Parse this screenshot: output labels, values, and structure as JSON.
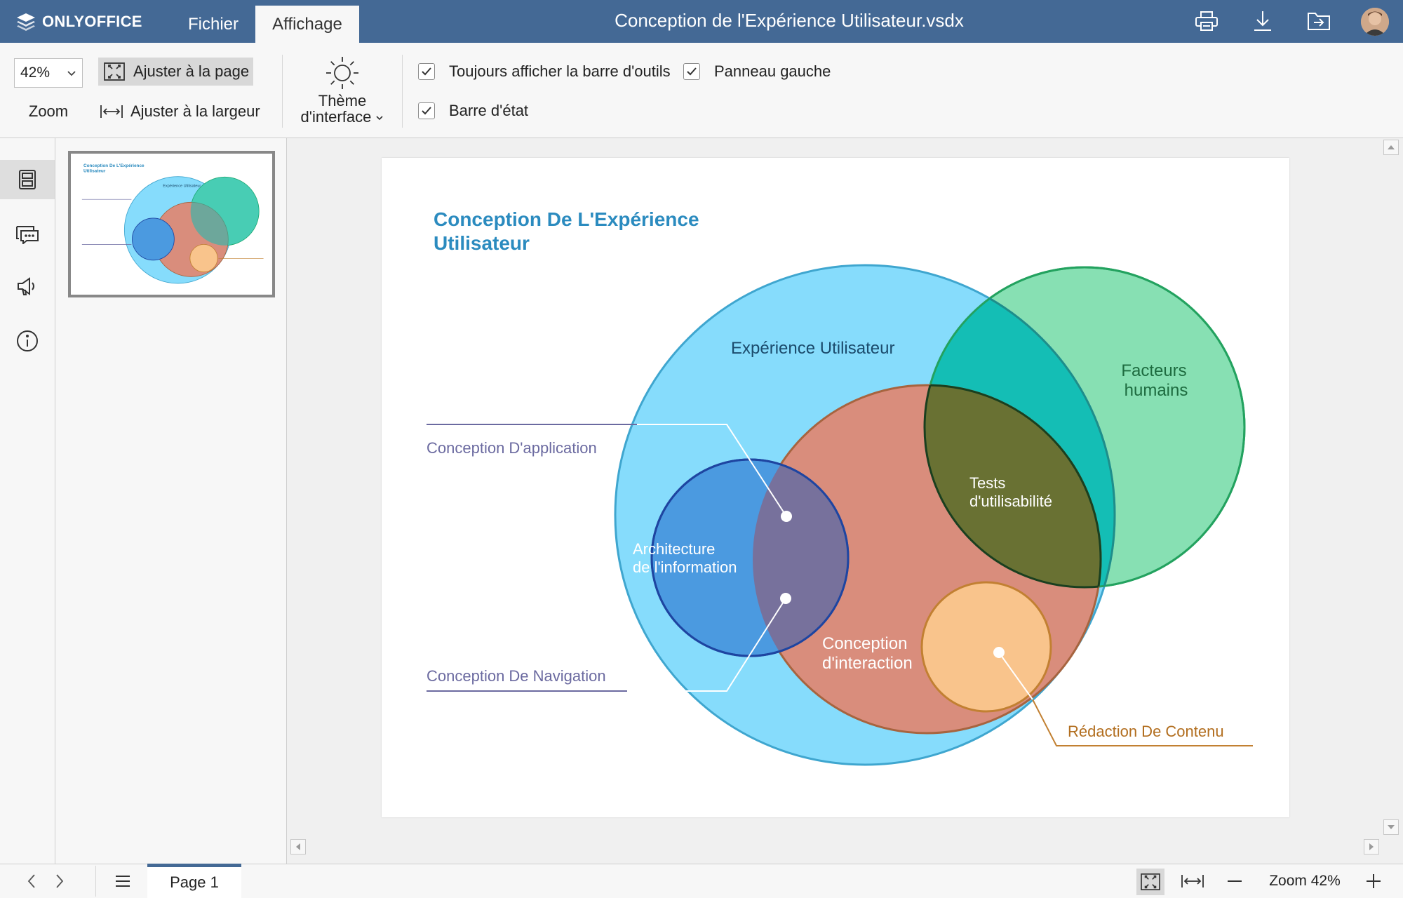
{
  "app": {
    "brand": "ONLYOFFICE",
    "title": "Conception de l'Expérience Utilisateur.vsdx"
  },
  "tabs": [
    {
      "label": "Fichier"
    },
    {
      "label": "Affichage",
      "active": true
    }
  ],
  "toolbar": {
    "zoom_value": "42%",
    "zoom_label": "Zoom",
    "fit_page": "Ajuster à la page",
    "fit_width": "Ajuster à la largeur",
    "theme_line1": "Thème",
    "theme_line2": "d'interface",
    "checkboxes": [
      {
        "label": "Toujours afficher la barre d'outils",
        "checked": true
      },
      {
        "label": "Panneau gauche",
        "checked": true
      },
      {
        "label": "Barre d'état",
        "checked": true
      }
    ]
  },
  "header_icons": [
    "print-icon",
    "download-icon",
    "open-location-icon",
    "user-avatar"
  ],
  "left_rail_icons": [
    "pages-icon",
    "comments-icon",
    "speaker-icon",
    "info-icon"
  ],
  "diagram": {
    "title_line1": "Conception De L'Expérience",
    "title_line2": "Utilisateur",
    "ux_label": "Expérience Utilisateur",
    "human_factors_line1": "Facteurs",
    "human_factors_line2": "humains",
    "usability_line1": "Tests",
    "usability_line2": "d'utilisabilité",
    "info_arch_line1": "Architecture",
    "info_arch_line2": "de l'information",
    "interaction_line1": "Conception",
    "interaction_line2": "d'interaction",
    "app_design": "Conception D'application",
    "nav_design": "Conception De Navigation",
    "content_writing": "Rédaction De Contenu",
    "colors": {
      "ux": "#86dcfc",
      "ux_stroke": "#3fa6cf",
      "human": "#87e0b3",
      "human_stroke": "#23a25f",
      "usability_overlap": "#14beb5",
      "interaction": "#d98d7c",
      "interaction_stroke": "#a7643f",
      "usability": "#697133",
      "usability_stroke": "#1a3f1f",
      "info_arch": "#4b9ae0",
      "info_arch_stroke": "#1e45a1",
      "info_overlap": "#77719c",
      "content": "#f9c48c",
      "content_stroke": "#c28032",
      "title": "#2b8bbf",
      "callout_line": "#6b6aa0",
      "content_label": "#b26e1f"
    }
  },
  "status": {
    "page_label": "Page 1",
    "zoom_text": "Zoom 42%"
  }
}
